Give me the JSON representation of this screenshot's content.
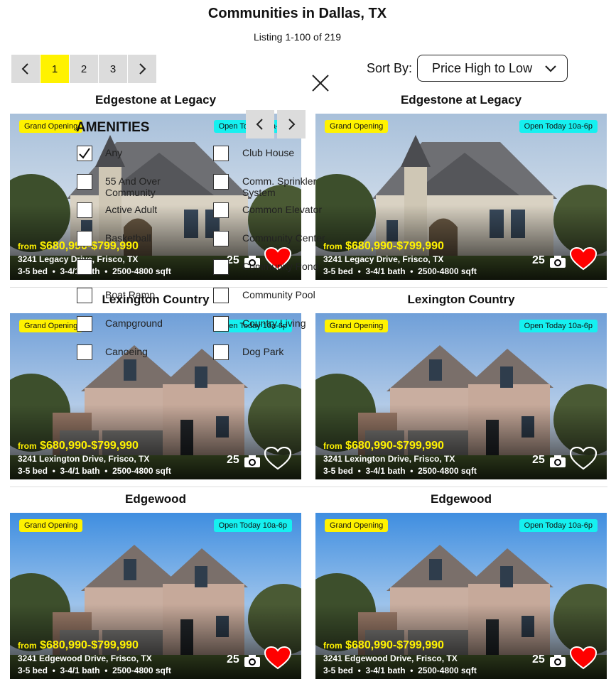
{
  "header": {
    "title": "Communities in Dallas, TX",
    "listing": "Listing 1-100 of 219"
  },
  "pager": {
    "pages": [
      "1",
      "2",
      "3"
    ],
    "active": "1"
  },
  "sort": {
    "label": "Sort By:",
    "value": "Price High to Low"
  },
  "badges": {
    "grand": "Grand Opening",
    "open": "Open Today 10a-6p"
  },
  "cards": [
    {
      "title": "Edgestone at Legacy",
      "price_from": "from",
      "price": "$680,990-$799,990",
      "address": "3241 Legacy Drive, Frisco, TX",
      "specs": "3-5 bed  •  3-4/1 bath  •  2500-4800 sqft",
      "photos": "25",
      "favorited": true
    },
    {
      "title": "Edgestone at Legacy",
      "price_from": "from",
      "price": "$680,990-$799,990",
      "address": "3241 Legacy Drive, Frisco, TX",
      "specs": "3-5 bed  •  3-4/1 bath  •  2500-4800 sqft",
      "photos": "25",
      "favorited": true
    },
    {
      "title": "Lexington Country",
      "price_from": "from",
      "price": "$680,990-$799,990",
      "address": "3241 Lexington Drive, Frisco, TX",
      "specs": "3-5 bed  •  3-4/1 bath  •  2500-4800 sqft",
      "photos": "25",
      "favorited": false
    },
    {
      "title": "Lexington Country",
      "price_from": "from",
      "price": "$680,990-$799,990",
      "address": "3241 Lexington Drive, Frisco, TX",
      "specs": "3-5 bed  •  3-4/1 bath  •  2500-4800 sqft",
      "photos": "25",
      "favorited": false
    },
    {
      "title": "Edgewood",
      "price_from": "from",
      "price": "$680,990-$799,990",
      "address": "3241 Edgewood Drive, Frisco, TX",
      "specs": "3-5 bed  •  3-4/1 bath  •  2500-4800 sqft",
      "photos": "25",
      "favorited": true
    },
    {
      "title": "Edgewood",
      "price_from": "from",
      "price": "$680,990-$799,990",
      "address": "3241 Edgewood Drive, Frisco, TX",
      "specs": "3-5 bed  •  3-4/1 bath  •  2500-4800 sqft",
      "photos": "25",
      "favorited": true
    }
  ],
  "amenities": {
    "title": "AMENITIES",
    "left": [
      {
        "label": "Any",
        "checked": true
      },
      {
        "label": "55 And Over Community",
        "checked": false
      },
      {
        "label": "Active Adult",
        "checked": false
      },
      {
        "label": "Basketball",
        "checked": false
      },
      {
        "label": "",
        "checked": false
      },
      {
        "label": "Boat Ramp",
        "checked": false
      },
      {
        "label": "Campground",
        "checked": false
      },
      {
        "label": "Canoeing",
        "checked": false
      }
    ],
    "right": [
      {
        "label": "Club House",
        "checked": false
      },
      {
        "label": "Comm. Sprinkler System",
        "checked": false
      },
      {
        "label": "Common Elevator",
        "checked": false
      },
      {
        "label": "Community Center",
        "checked": false
      },
      {
        "label": "Community Pond",
        "checked": false
      },
      {
        "label": "Community Pool",
        "checked": false
      },
      {
        "label": "Country Living",
        "checked": false
      },
      {
        "label": "Dog Park",
        "checked": false
      }
    ]
  },
  "colors": {
    "accent": "#fff200",
    "open_badge": "#16f0f0",
    "heart": "#ff0000"
  },
  "icons": [
    "chevron-left-icon",
    "chevron-right-icon",
    "chevron-down-icon",
    "close-icon",
    "camera-icon",
    "heart-icon",
    "checkmark-icon"
  ]
}
